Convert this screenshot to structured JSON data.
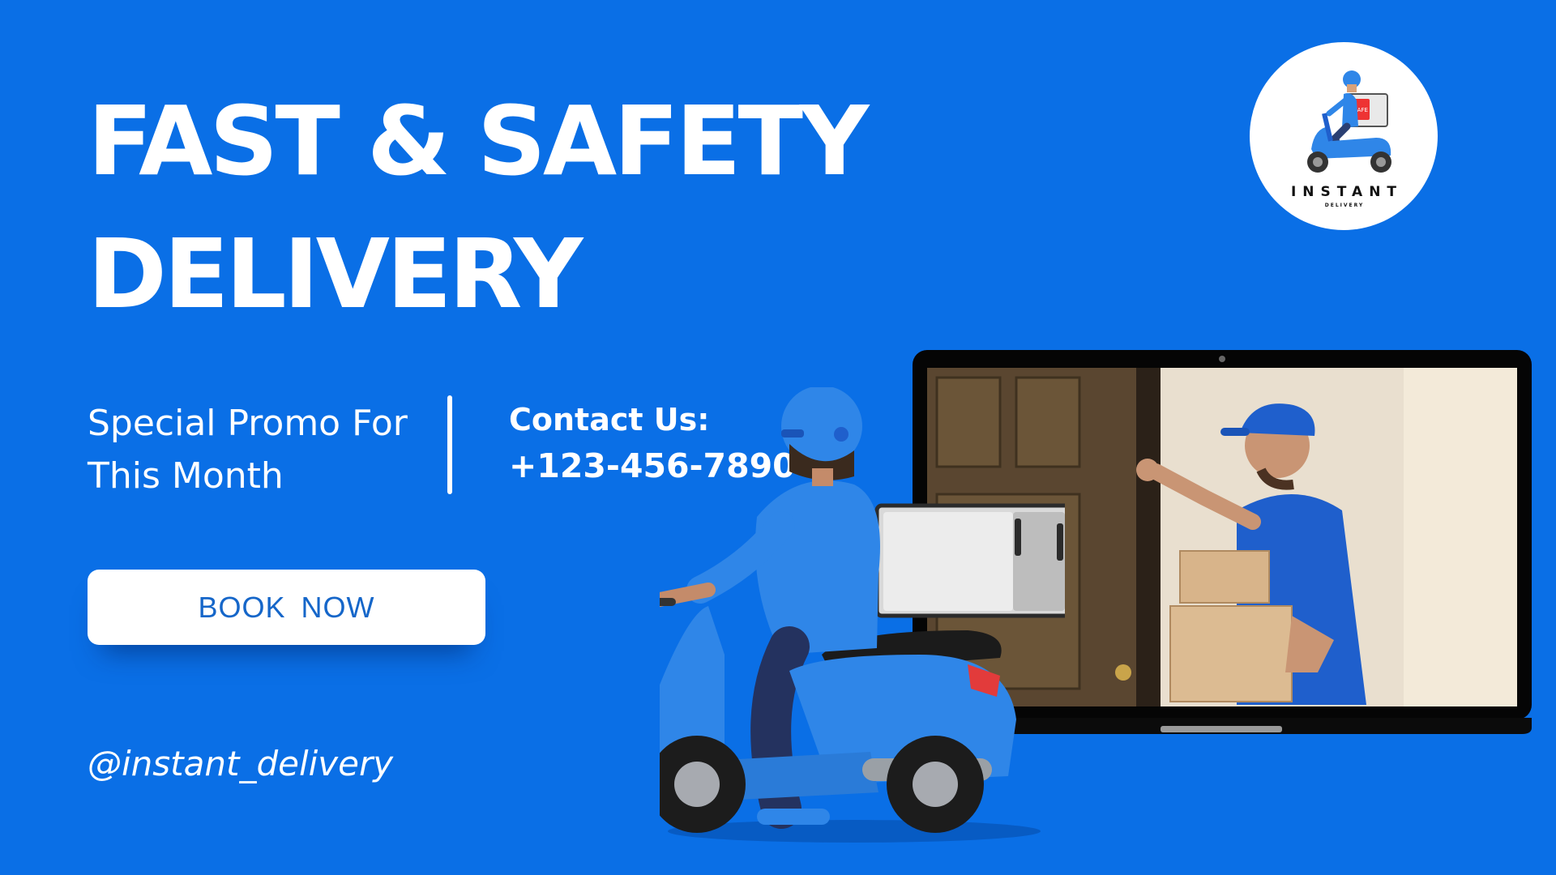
{
  "headline": {
    "line1": "FAST & SAFETY",
    "line2": "DELIVERY"
  },
  "promo": {
    "line1": "Special Promo For",
    "line2": "This Month"
  },
  "contact": {
    "label": "Contact Us:",
    "phone": "+123-456-7890"
  },
  "cta": {
    "label": "BOOK  NOW"
  },
  "social": {
    "handle": "@instant_delivery"
  },
  "logo": {
    "word": "INSTANT",
    "subword": "DELIVERY",
    "box_badge": "SAFE",
    "icon": "scooter-courier-icon"
  },
  "illustration": {
    "laptop_icon": "laptop-icon",
    "photo_subject": "courier-at-door-photo",
    "rider_icon": "scooter-rider-icon"
  },
  "colors": {
    "background": "#0a6fe6",
    "text": "#ffffff",
    "button_bg": "#ffffff",
    "button_text": "#1566c9",
    "scooter_blue": "#2f86e8",
    "courier_blue": "#1f5fcc"
  }
}
